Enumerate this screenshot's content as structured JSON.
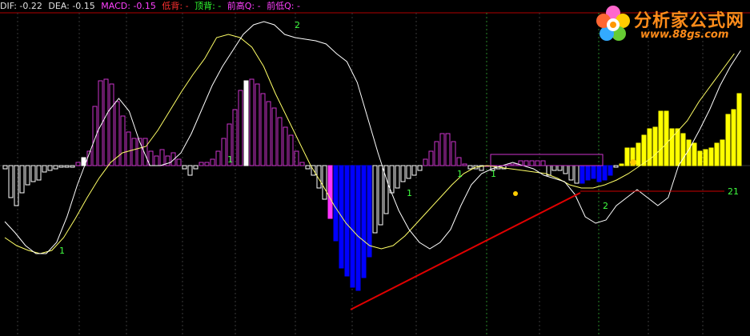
{
  "header": {
    "dif": "DIF: -0.22",
    "dea": "DEA: -0.15",
    "macd": "MACD: -0.15",
    "low_div": "低背: -",
    "top_div": "顶背: -",
    "prev_high": "前高Q: -",
    "prev_low": "前低Q: -"
  },
  "logo": {
    "title": "分析家公式网",
    "url": "www.88gs.com"
  },
  "colors": {
    "background": "#000000",
    "positive_bar": "#cc33cc",
    "negative_bar": "#ffffff",
    "blue_bar": "#0000ff",
    "yellow_bar": "#ffff00",
    "white_peak": "#ffffff",
    "dif_line": "#ffffff",
    "dea_line": "#ffff66",
    "trend_line": "#e00000",
    "ref_line": "#cc0000",
    "label_green": "#40ff40"
  },
  "chart_data": {
    "type": "bar",
    "title": "",
    "xlabel": "",
    "ylabel": "",
    "ylim": [
      -1.0,
      0.69
    ],
    "macd_values": [
      -0.02,
      -0.2,
      -0.25,
      -0.17,
      -0.12,
      -0.1,
      -0.09,
      -0.04,
      -0.03,
      -0.02,
      -0.01,
      -0.01,
      -0.01,
      0.02,
      0.05,
      0.09,
      0.37,
      0.53,
      0.54,
      0.51,
      0.4,
      0.31,
      0.21,
      0.17,
      0.17,
      0.17,
      0.09,
      0.06,
      0.1,
      0.06,
      0.08,
      0.04,
      -0.02,
      -0.06,
      -0.02,
      0.02,
      0.02,
      0.04,
      0.09,
      0.17,
      0.26,
      0.35,
      0.47,
      0.53,
      0.54,
      0.51,
      0.45,
      0.4,
      0.36,
      0.3,
      0.24,
      0.19,
      0.09,
      0.02,
      -0.02,
      -0.06,
      -0.14,
      -0.21,
      -0.33,
      -0.47,
      -0.64,
      -0.69,
      -0.76,
      -0.78,
      -0.7,
      -0.57,
      -0.42,
      -0.37,
      -0.3,
      -0.17,
      -0.14,
      -0.1,
      -0.08,
      -0.06,
      -0.03,
      0.04,
      0.09,
      0.15,
      0.2,
      0.2,
      0.15,
      0.05,
      0.01,
      -0.02,
      -0.02,
      -0.03,
      0.0,
      -0.03,
      -0.02,
      -0.02,
      0.01,
      0.01,
      0.03,
      0.03,
      0.03,
      0.03,
      0.03,
      -0.06,
      -0.03,
      -0.03,
      -0.05,
      -0.09,
      -0.11,
      -0.11,
      -0.09,
      -0.08,
      -0.1,
      -0.09,
      -0.06,
      -0.01,
      0.01,
      0.11,
      0.11,
      0.14,
      0.19,
      0.23,
      0.24,
      0.34,
      0.34,
      0.23,
      0.23,
      0.2,
      0.16,
      0.14,
      0.09,
      0.1,
      0.11,
      0.14,
      0.16,
      0.32,
      0.35,
      0.45
    ],
    "special_bars": {
      "white_peaks": [
        14,
        43
      ],
      "magenta_neg": [
        58
      ],
      "blue_neg_range": [
        59,
        65
      ],
      "blue_flat_range": [
        103,
        108
      ],
      "yellow_range": [
        108,
        131
      ]
    },
    "dif_values": [
      -0.35,
      -0.42,
      -0.5,
      -0.55,
      -0.55,
      -0.48,
      -0.32,
      -0.12,
      0.05,
      0.22,
      0.34,
      0.42,
      0.34,
      0.15,
      0.0,
      0.0,
      0.02,
      0.08,
      0.2,
      0.35,
      0.5,
      0.62,
      0.72,
      0.82,
      0.88,
      0.9,
      0.88,
      0.82,
      0.8,
      0.79,
      0.78,
      0.76,
      0.7,
      0.65,
      0.52,
      0.3,
      0.08,
      -0.12,
      -0.28,
      -0.4,
      -0.48,
      -0.52,
      -0.48,
      -0.4,
      -0.25,
      -0.12,
      -0.05,
      -0.02,
      0.0,
      0.02,
      0.0,
      -0.02,
      -0.06,
      -0.08,
      -0.1,
      -0.18,
      -0.32,
      -0.36,
      -0.34,
      -0.25,
      -0.2,
      -0.15,
      -0.2,
      -0.25,
      -0.2,
      0.0,
      0.1,
      0.22,
      0.35,
      0.5,
      0.62,
      0.72
    ],
    "dea_values": [
      -0.45,
      -0.5,
      -0.53,
      -0.55,
      -0.53,
      -0.45,
      -0.33,
      -0.2,
      -0.08,
      0.02,
      0.08,
      0.1,
      0.12,
      0.22,
      0.34,
      0.46,
      0.57,
      0.67,
      0.8,
      0.82,
      0.8,
      0.74,
      0.62,
      0.45,
      0.3,
      0.15,
      0.0,
      -0.12,
      -0.25,
      -0.36,
      -0.44,
      -0.5,
      -0.52,
      -0.5,
      -0.44,
      -0.36,
      -0.28,
      -0.2,
      -0.12,
      -0.05,
      -0.01,
      0.0,
      -0.01,
      -0.02,
      -0.03,
      -0.04,
      -0.05,
      -0.08,
      -0.12,
      -0.14,
      -0.14,
      -0.12,
      -0.09,
      -0.05,
      0.0,
      0.05,
      0.12,
      0.2,
      0.28,
      0.4,
      0.5,
      0.6,
      0.7
    ],
    "trend_line": {
      "from_bar": 62,
      "from_value": -0.9,
      "to_bar": 103,
      "to_value": -0.17
    },
    "ref_line": {
      "value": -0.16,
      "label": "21"
    },
    "annotations": [
      {
        "text": "1",
        "color": "#40ff40",
        "bar": 10,
        "value": -0.55
      },
      {
        "text": "1",
        "color": "#40ff40",
        "bar": 40,
        "value": 0.02
      },
      {
        "text": "2",
        "color": "#40ff40",
        "bar": 52,
        "value": 0.86
      },
      {
        "text": "1",
        "color": "#40ff40",
        "bar": 72,
        "value": -0.19
      },
      {
        "text": "1",
        "color": "#40ff40",
        "bar": 81,
        "value": -0.07
      },
      {
        "text": "1",
        "color": "#40ff40",
        "bar": 87,
        "value": -0.07
      },
      {
        "text": "2",
        "color": "#40ff40",
        "bar": 107,
        "value": -0.27
      }
    ]
  }
}
